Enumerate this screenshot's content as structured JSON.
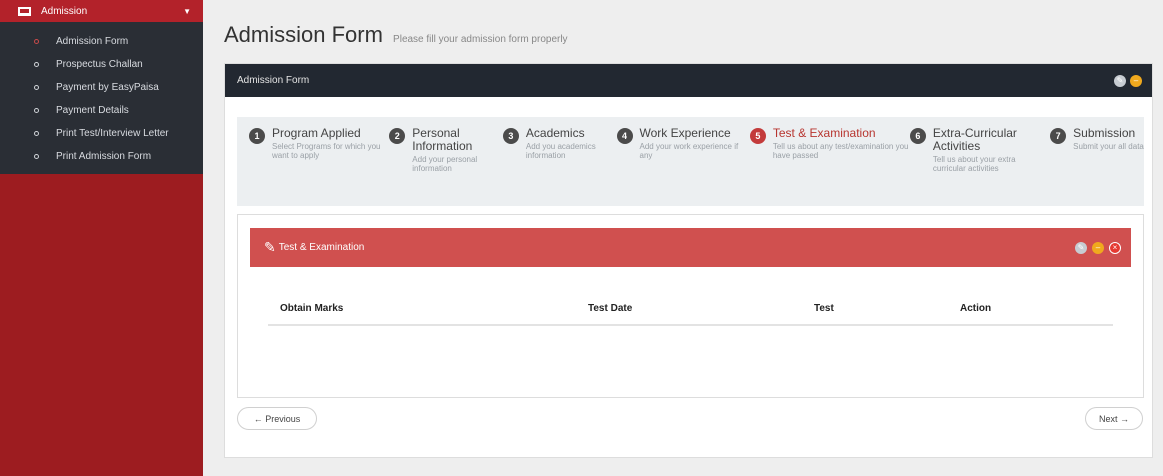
{
  "sidebar": {
    "section_label": "Admission",
    "items": [
      {
        "label": "Admission Form"
      },
      {
        "label": "Prospectus Challan"
      },
      {
        "label": "Payment by EasyPaisa"
      },
      {
        "label": "Payment Details"
      },
      {
        "label": "Print Test/Interview Letter"
      },
      {
        "label": "Print Admission Form"
      }
    ]
  },
  "page": {
    "title": "Admission Form",
    "subtitle": "Please fill your admission form properly"
  },
  "widget": {
    "title": "Admission Form",
    "colors": {
      "header_bg": "#222831",
      "accent_red": "#d0504f",
      "sidebar_bg": "#9d1c20"
    }
  },
  "steps": [
    {
      "num": "1",
      "title": "Program Applied",
      "desc": "Select Programs for which you want to apply"
    },
    {
      "num": "2",
      "title": "Personal Information",
      "desc": "Add your personal information"
    },
    {
      "num": "3",
      "title": "Academics",
      "desc": "Add you academics information"
    },
    {
      "num": "4",
      "title": "Work Experience",
      "desc": "Add your work experience if any"
    },
    {
      "num": "5",
      "title": "Test & Examination",
      "desc": "Tell us about any test/examination you have passed"
    },
    {
      "num": "6",
      "title": "Extra-Curricular Activities",
      "desc": "Tell us about your extra curricular activities"
    },
    {
      "num": "7",
      "title": "Submission",
      "desc": "Submit your all data"
    }
  ],
  "section": {
    "title": "Test & Examination"
  },
  "table": {
    "headers": [
      "Obtain Marks",
      "Test Date",
      "Test",
      "Action"
    ]
  },
  "nav": {
    "previous": "← Previous",
    "next": "Next →"
  }
}
